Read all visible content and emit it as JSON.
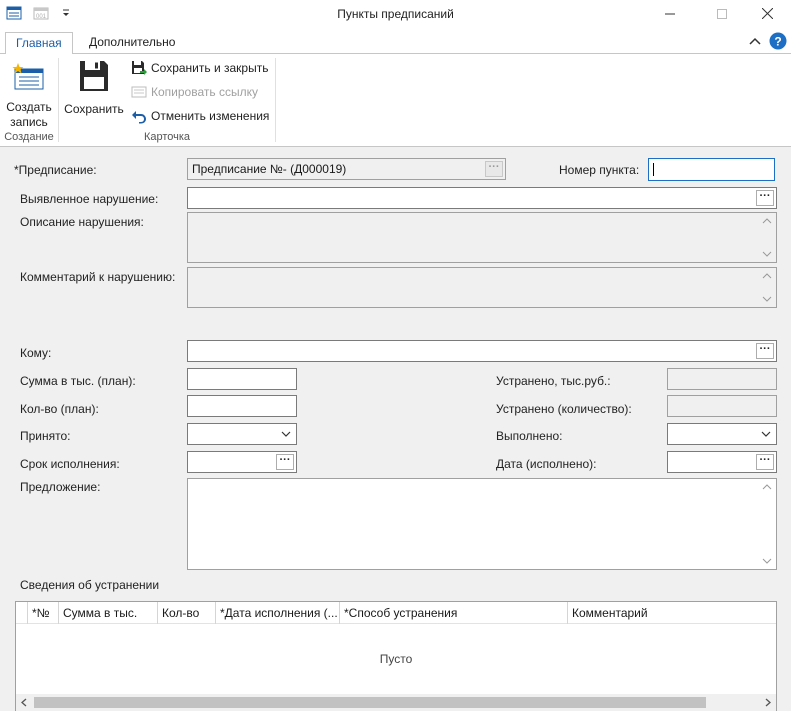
{
  "window": {
    "title": "Пункты предписаний",
    "minimize_icon": "minimize-icon",
    "maximize_icon": "maximize-icon",
    "close_icon": "close-icon"
  },
  "ribbon": {
    "tabs": [
      {
        "label": "Главная",
        "active": true
      },
      {
        "label": "Дополнительно",
        "active": false
      }
    ],
    "groups": {
      "creation": {
        "label": "Создание",
        "create_button": "Создать запись"
      },
      "card": {
        "label": "Карточка",
        "save_button": "Сохранить",
        "save_close": "Сохранить и закрыть",
        "copy_link": "Копировать ссылку",
        "undo_changes": "Отменить изменения"
      }
    }
  },
  "form": {
    "order_label": "*Предписание:",
    "order_value": "Предписание №- (Д000019)",
    "item_number_label": "Номер пункта:",
    "item_number_value": "",
    "violation_label": "Выявленное нарушение:",
    "violation_value": "",
    "description_label": "Описание нарушения:",
    "comment_label": "Комментарий к нарушению:",
    "to_whom_label": "Кому:",
    "sum_plan_label": "Сумма в тыс. (план):",
    "qty_plan_label": "Кол-во (план):",
    "accepted_label": "Принято:",
    "deadline_label": "Срок исполнения:",
    "proposal_label": "Предложение:",
    "fixed_sum_label": "Устранено, тыс.руб.:",
    "fixed_qty_label": "Устранено (количество):",
    "done_label": "Выполнено:",
    "done_date_label": "Дата (исполнено):",
    "elimination_section": "Сведения об устранении"
  },
  "grid": {
    "columns": [
      "*№",
      "Сумма в тыс.",
      "Кол-во",
      "*Дата исполнения (...",
      "*Способ устранения",
      "Комментарий"
    ],
    "empty_text": "Пусто"
  }
}
